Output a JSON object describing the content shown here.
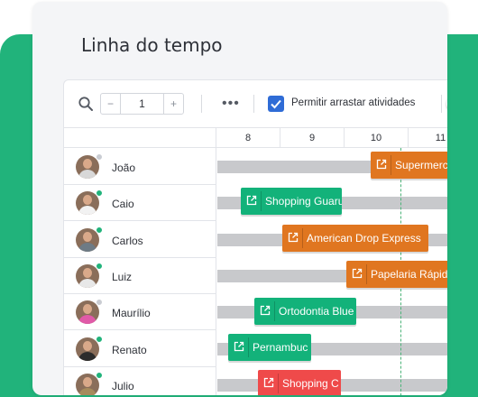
{
  "page": {
    "title": "Linha do tempo"
  },
  "toolbar": {
    "zoom": {
      "minus": "−",
      "value": "1",
      "plus": "+"
    },
    "more": "•••",
    "checkbox_label": "Permitir arrastar atividades",
    "checkbox_checked": true
  },
  "timeline": {
    "hours": [
      "8",
      "9",
      "10",
      "11"
    ]
  },
  "people": [
    {
      "name": "João",
      "status_color": "#c9ccd2",
      "shirt": "#d8d8d8"
    },
    {
      "name": "Caio",
      "status_color": "#21b37b",
      "shirt": "#f2f2f2"
    },
    {
      "name": "Carlos",
      "status_color": "#21b37b",
      "shirt": "#6e7b85"
    },
    {
      "name": "Luiz",
      "status_color": "#21b37b",
      "shirt": "#e8e8e8"
    },
    {
      "name": "Maurílio",
      "status_color": "#c9ccd2",
      "shirt": "#e05aa8"
    },
    {
      "name": "Renato",
      "status_color": "#21b37b",
      "shirt": "#2c2c2c"
    },
    {
      "name": "Julio",
      "status_color": "#21b37b",
      "shirt": "#a68b5c"
    }
  ],
  "tasks": [
    {
      "label": "Supermercado",
      "color": "#e07620"
    },
    {
      "label": "Shopping Guarulhos",
      "color": "#13b27a"
    },
    {
      "label": "American Drop Express",
      "color": "#e07620"
    },
    {
      "label": "Papelaria Rápida",
      "color": "#e07620"
    },
    {
      "label": "Ortodontia Blue",
      "color": "#13b27a"
    },
    {
      "label": "Pernambuc",
      "color": "#13b27a"
    },
    {
      "label": "Shopping C",
      "color": "#ef4a4a"
    }
  ],
  "colors": {
    "brand_green": "#21b37b",
    "accent_blue": "#2f6cd6",
    "orange": "#e07620",
    "red": "#ef4a4a"
  }
}
